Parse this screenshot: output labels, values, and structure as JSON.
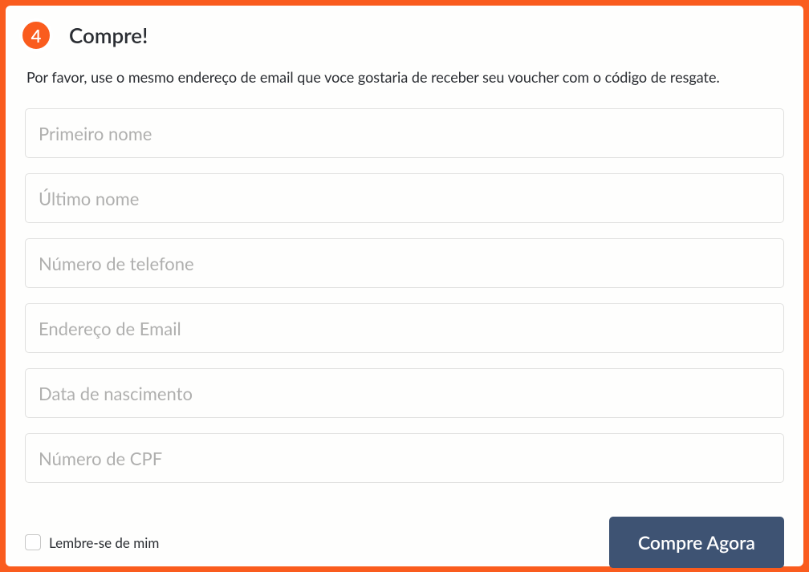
{
  "step": {
    "number": "4",
    "title": "Compre!"
  },
  "instruction": "Por favor, use o mesmo endereço de email que voce gostaria de receber seu voucher com o código de resgate.",
  "fields": {
    "first_name": {
      "placeholder": "Primeiro nome",
      "value": ""
    },
    "last_name": {
      "placeholder": "Último nome",
      "value": ""
    },
    "phone": {
      "placeholder": "Número de telefone",
      "value": ""
    },
    "email": {
      "placeholder": "Endereço de Email",
      "value": ""
    },
    "dob": {
      "placeholder": "Data de nascimento",
      "value": ""
    },
    "cpf": {
      "placeholder": "Número de CPF",
      "value": ""
    }
  },
  "remember": {
    "label": "Lembre-se de mim",
    "checked": false
  },
  "submit": {
    "label": "Compre Agora"
  }
}
